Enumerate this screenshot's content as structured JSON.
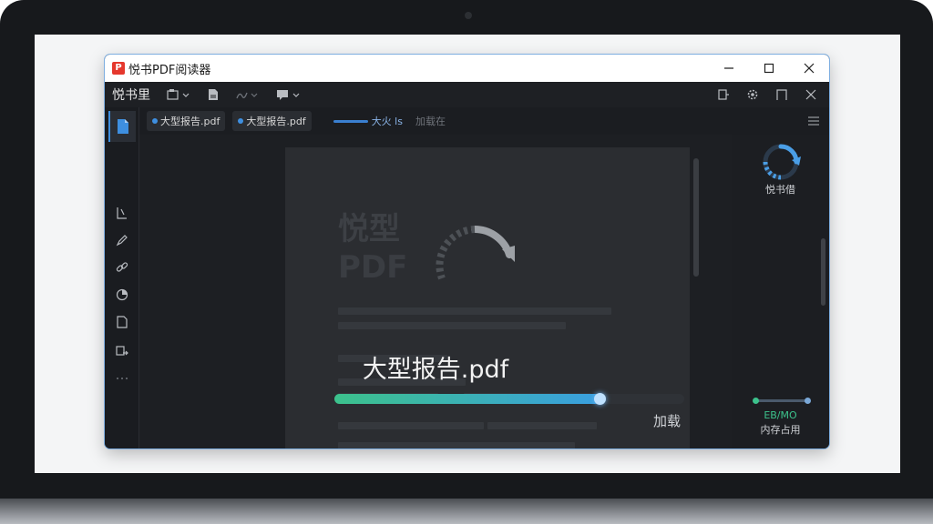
{
  "window": {
    "title": "悦书PDF阅读器",
    "logo_text": "P"
  },
  "toolbar": {
    "brand": "悦书里"
  },
  "tabs": [
    {
      "label": "大型报告.pdf"
    },
    {
      "label": "大型报告.pdf"
    }
  ],
  "tab_loading": {
    "label": "大火 ls",
    "status": "加载在"
  },
  "document": {
    "heading": "悦型",
    "subheading": "PDF"
  },
  "loading": {
    "file_name": "大型报告.pdf",
    "progress_fraction": 0.76,
    "status": "加载"
  },
  "right_panel": {
    "spinner_label": "悦书借",
    "memory_value": "EB/MO",
    "memory_label": "内存占用"
  },
  "colors": {
    "accent": "#3e8fe0",
    "progress_start": "#3cc28c",
    "progress_end": "#3a9fe0",
    "app_red": "#e5382d"
  }
}
